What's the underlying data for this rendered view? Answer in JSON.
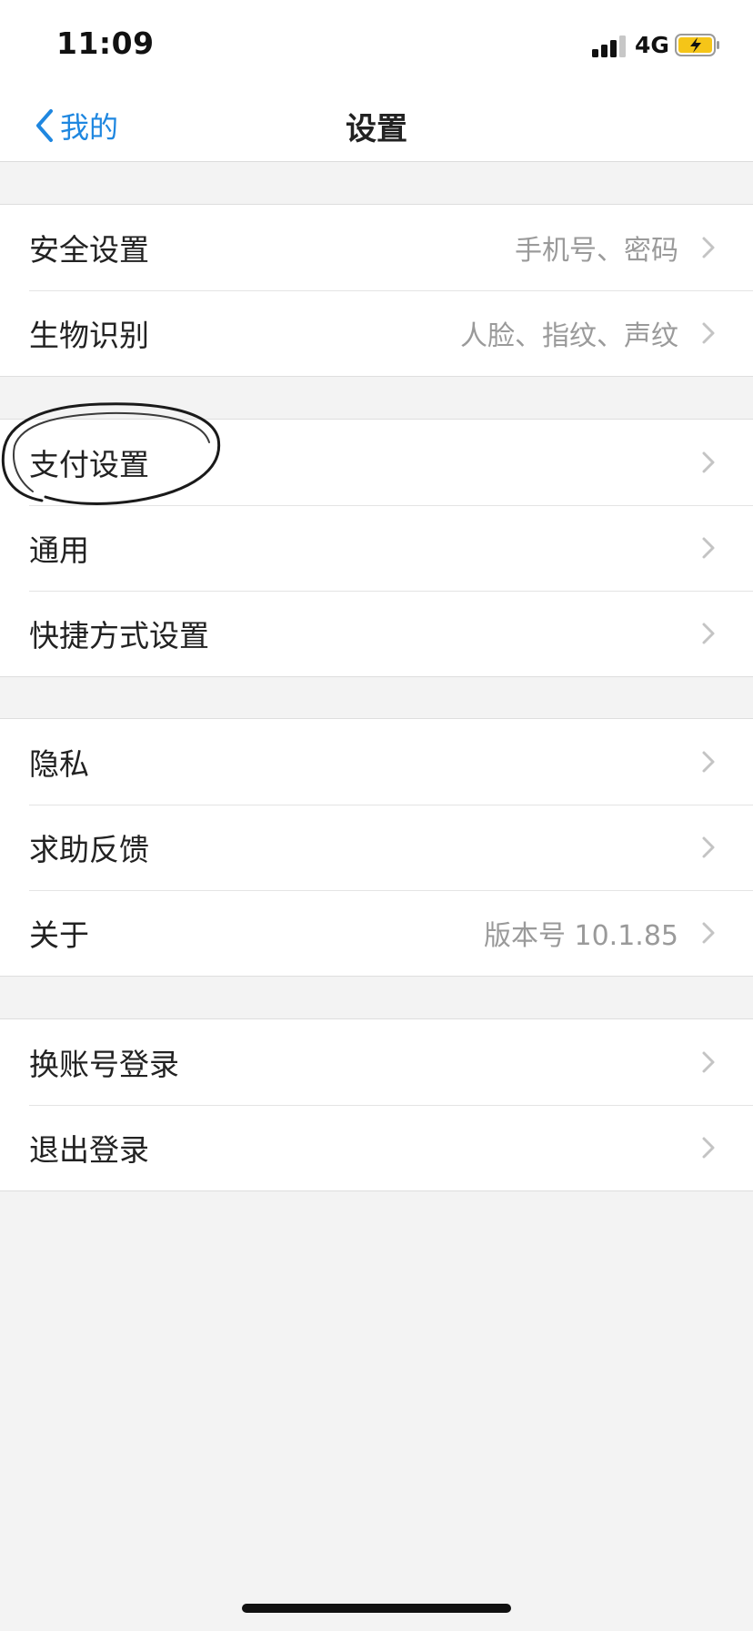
{
  "status_bar": {
    "time": "11:09",
    "network": "4G",
    "signal_icon": "cellular-signal-icon",
    "battery_icon": "battery-charging-icon",
    "battery_color": "#f5c518"
  },
  "nav": {
    "back_label": "我的",
    "back_icon": "chevron-left-icon",
    "title": "设置",
    "accent_color": "#1f87e0"
  },
  "groups": [
    {
      "rows": [
        {
          "label": "安全设置",
          "value": "手机号、密码"
        },
        {
          "label": "生物识别",
          "value": "人脸、指纹、声纹"
        }
      ]
    },
    {
      "rows": [
        {
          "label": "支付设置",
          "value": ""
        },
        {
          "label": "通用",
          "value": ""
        },
        {
          "label": "快捷方式设置",
          "value": ""
        }
      ]
    },
    {
      "rows": [
        {
          "label": "隐私",
          "value": ""
        },
        {
          "label": "求助反馈",
          "value": ""
        },
        {
          "label": "关于",
          "value": "版本号 10.1.85"
        }
      ]
    },
    {
      "rows": [
        {
          "label": "换账号登录",
          "value": ""
        },
        {
          "label": "退出登录",
          "value": ""
        }
      ]
    }
  ]
}
